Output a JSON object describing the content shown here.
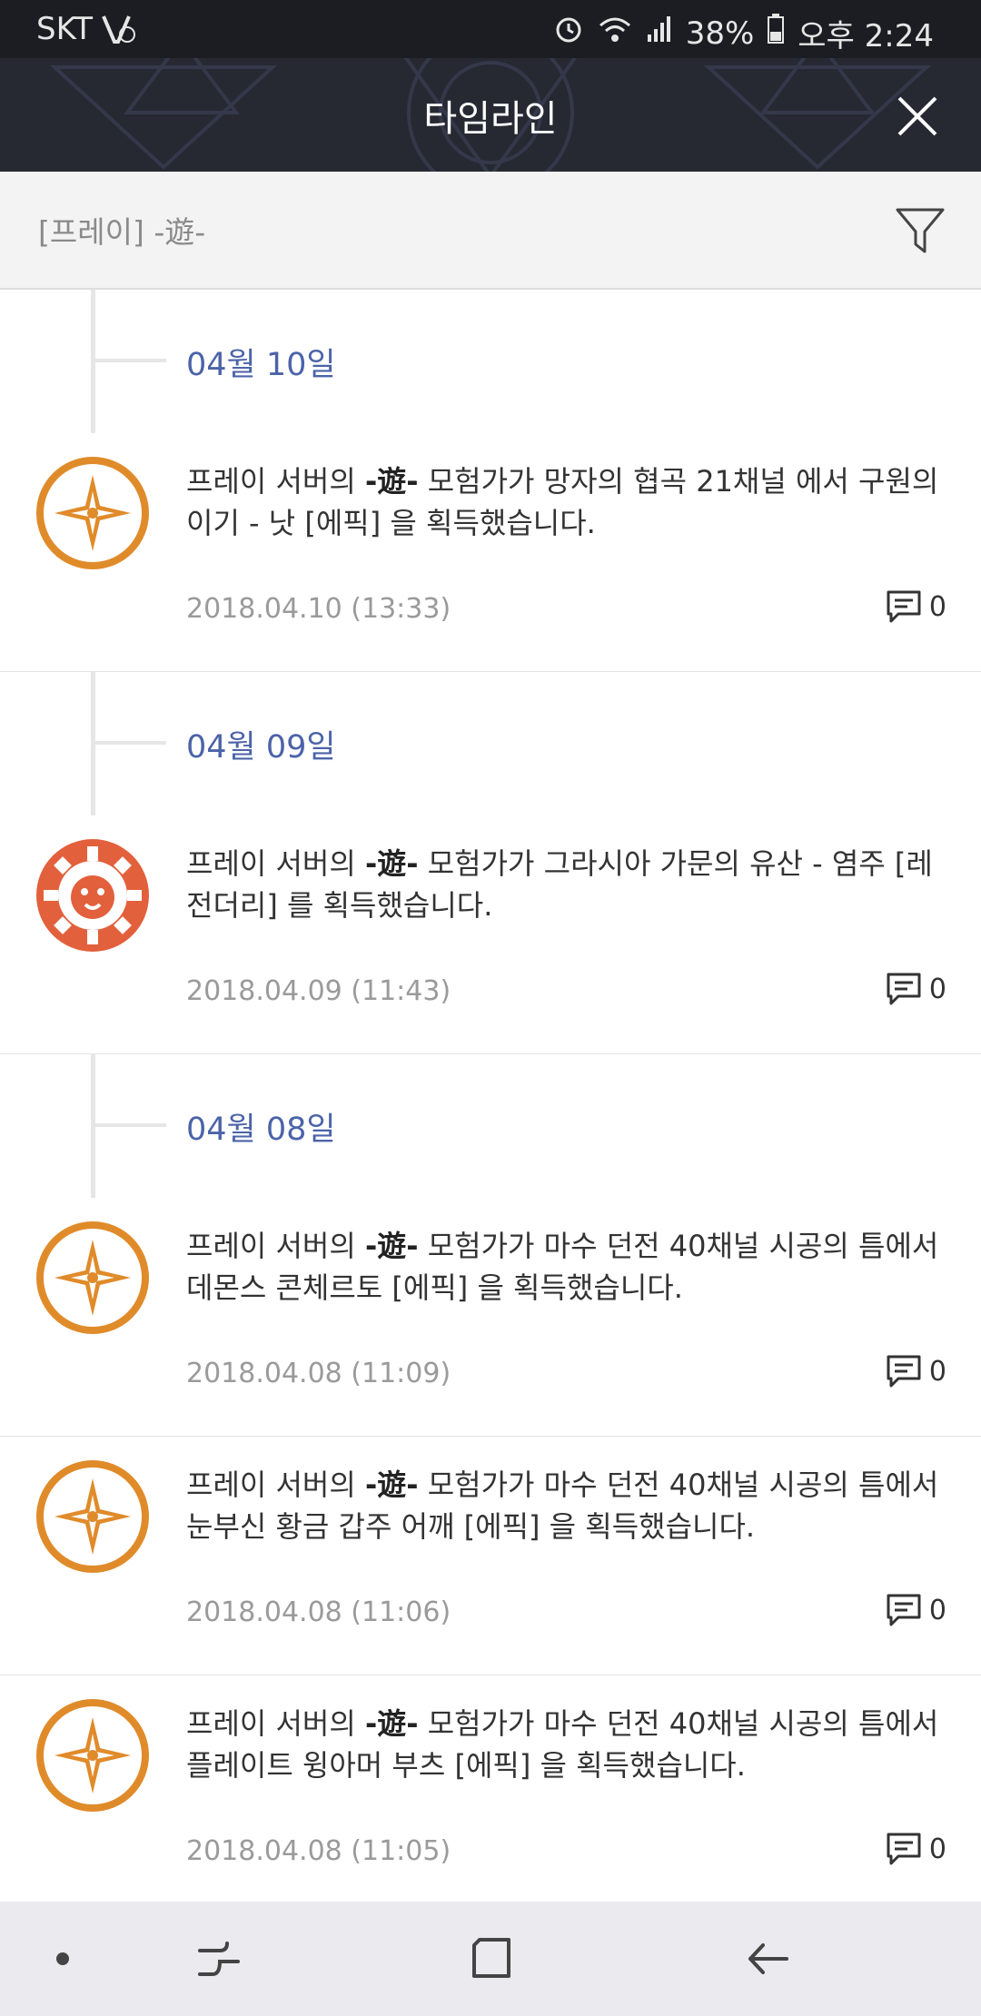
{
  "status_bar": {
    "carrier": "SKT",
    "battery": "38%",
    "time": "오후 2:24",
    "icons": [
      "network-lte-icon",
      "alarm-icon",
      "wifi-icon",
      "signal-icon",
      "battery-icon"
    ]
  },
  "header": {
    "title": "타임라인",
    "close_icon": "close-icon"
  },
  "filter_bar": {
    "text": "[프레이] -遊-",
    "filter_icon": "filter-icon"
  },
  "timeline": {
    "groups": [
      {
        "date": "04월 10일",
        "entries": [
          {
            "prefix": "프레이 서버의 ",
            "name": "-遊-",
            "suffix": " 모험가가 망자의 협곡 21채널 에서 구원의 이기 - 낫 [에픽] 을 획득했습니다.",
            "time": "2018.04.10 (13:33)",
            "comments": "0",
            "rarity": "epic"
          }
        ]
      },
      {
        "date": "04월 09일",
        "entries": [
          {
            "prefix": "프레이 서버의 ",
            "name": "-遊-",
            "suffix": " 모험가가 그라시아 가문의 유산 - 염주 [레전더리] 를 획득했습니다.",
            "time": "2018.04.09 (11:43)",
            "comments": "0",
            "rarity": "legendary"
          }
        ]
      },
      {
        "date": "04월 08일",
        "entries": [
          {
            "prefix": "프레이 서버의 ",
            "name": "-遊-",
            "suffix": " 모험가가 마수 던전 40채널 시공의 틈에서 데몬스 콘체르토 [에픽] 을 획득했습니다.",
            "time": "2018.04.08 (11:09)",
            "comments": "0",
            "rarity": "epic"
          },
          {
            "prefix": "프레이 서버의 ",
            "name": "-遊-",
            "suffix": " 모험가가 마수 던전 40채널 시공의 틈에서 눈부신 황금 갑주 어깨 [에픽] 을 획득했습니다.",
            "time": "2018.04.08 (11:06)",
            "comments": "0",
            "rarity": "epic"
          },
          {
            "prefix": "프레이 서버의 ",
            "name": "-遊-",
            "suffix": " 모험가가 마수 던전 40채널 시공의 틈에서 플레이트 윙아머 부츠 [에픽] 을 획득했습니다.",
            "time": "2018.04.08 (11:05)",
            "comments": "0",
            "rarity": "epic"
          }
        ]
      }
    ]
  },
  "colors": {
    "epic": "#e08b2a",
    "legendary": "#e2603c",
    "date_label": "#4b63a8",
    "header_bg": "#262932"
  },
  "nav_bar": {
    "buttons": [
      "dot-icon",
      "recent-apps-icon",
      "home-icon",
      "back-icon"
    ]
  }
}
